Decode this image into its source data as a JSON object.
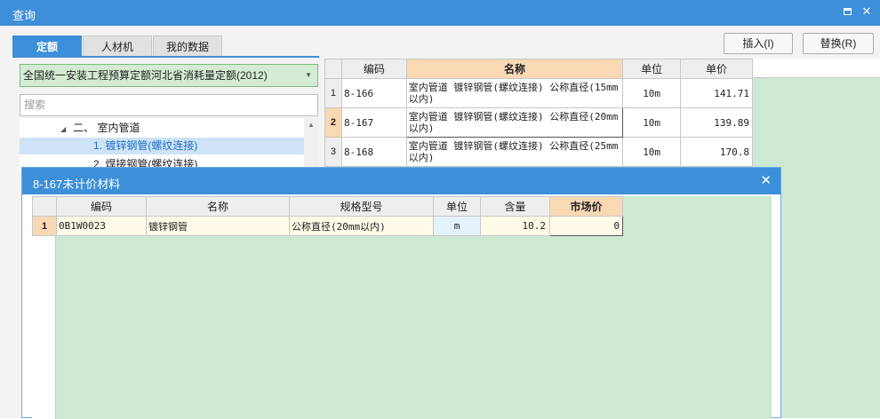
{
  "window": {
    "title": "查询"
  },
  "tabs": [
    {
      "label": "定额",
      "active": true
    },
    {
      "label": "人材机",
      "active": false
    },
    {
      "label": "我的数据",
      "active": false
    }
  ],
  "buttons": {
    "insert": "插入(I)",
    "replace": "替换(R)"
  },
  "left": {
    "library": "全国统一安装工程预算定额河北省消耗量定额(2012)",
    "search_placeholder": "搜索",
    "tree": [
      {
        "label": "二、 室内管道",
        "expand": "◢"
      },
      {
        "label": "1. 镀锌钢管(螺纹连接)"
      },
      {
        "label": "2. 焊接钢管(螺纹连接)"
      }
    ]
  },
  "grid": {
    "headers": [
      "编码",
      "名称",
      "单位",
      "单价"
    ],
    "rows": [
      {
        "n": "1",
        "code": "8-166",
        "name": "室内管道 镀锌钢管(螺纹连接) 公称直径(15mm以内)",
        "unit": "10m",
        "price": "141.71"
      },
      {
        "n": "2",
        "code": "8-167",
        "name": "室内管道 镀锌钢管(螺纹连接) 公称直径(20mm以内)",
        "unit": "10m",
        "price": "139.89"
      },
      {
        "n": "3",
        "code": "8-168",
        "name": "室内管道 镀锌钢管(螺纹连接) 公称直径(25mm以内)",
        "unit": "10m",
        "price": "170.8"
      }
    ]
  },
  "dialog": {
    "title": "8-167未计价材料",
    "headers": [
      "编码",
      "名称",
      "规格型号",
      "单位",
      "含量",
      "市场价"
    ],
    "rows": [
      {
        "n": "1",
        "code": "0B1W0023",
        "name": "镀锌钢管",
        "spec": "公称直径(20mm以内)",
        "unit": "m",
        "qty": "10.2",
        "price": "0"
      }
    ]
  },
  "colors": {
    "accent": "#3c8fd8",
    "green_fill": "#cde8d3",
    "header_highlight": "#f8d9b4"
  }
}
